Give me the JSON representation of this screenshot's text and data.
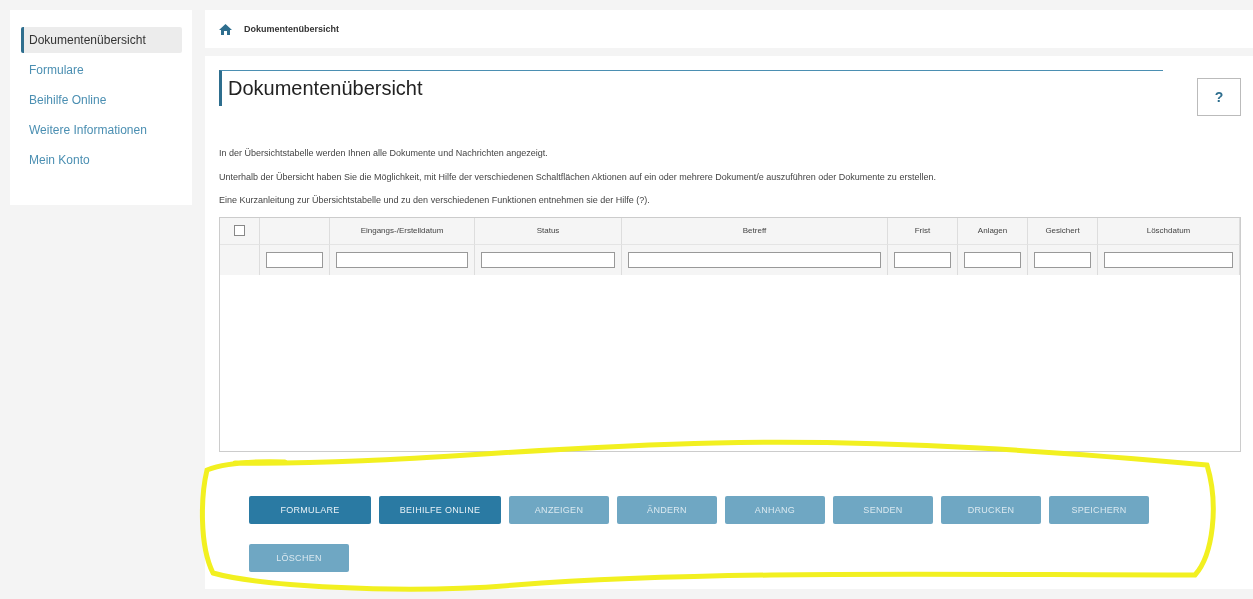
{
  "sidebar": {
    "items": [
      {
        "label": "Dokumentenübersicht",
        "selected": true
      },
      {
        "label": "Formulare",
        "selected": false
      },
      {
        "label": "Beihilfe Online",
        "selected": false
      },
      {
        "label": "Weitere Informationen",
        "selected": false
      },
      {
        "label": "Mein Konto",
        "selected": false
      }
    ]
  },
  "breadcrumb": {
    "label": "Dokumentenübersicht"
  },
  "page": {
    "title": "Dokumentenübersicht",
    "help_button": "?",
    "paragraphs": [
      "In der Übersichtstabelle werden Ihnen alle Dokumente und Nachrichten angezeigt.",
      "Unterhalb der Übersicht haben Sie die Möglichkeit, mit Hilfe der verschiedenen Schaltflächen Aktionen auf ein oder mehrere Dokument/e auszuführen oder Dokumente zu erstellen.",
      "Eine Kurzanleitung zur Übersichtstabelle und zu den verschiedenen Funktionen entnehmen sie der Hilfe (?)."
    ]
  },
  "table": {
    "select_all": {
      "checked": false
    },
    "columns": [
      {},
      {
        "label": "Eingangs-/Erstelldatum"
      },
      {
        "label": "Status"
      },
      {
        "label": "Betreff"
      },
      {
        "label": "Frist"
      },
      {
        "label": "Anlagen"
      },
      {
        "label": "Gesichert"
      },
      {
        "label": "Löschdatum"
      }
    ]
  },
  "buttons": [
    {
      "label": "FORMULARE",
      "disabled": false
    },
    {
      "label": "BEIHILFE ONLINE",
      "disabled": false
    },
    {
      "label": "ANZEIGEN",
      "disabled": true
    },
    {
      "label": "ÄNDERN",
      "disabled": true
    },
    {
      "label": "ANHANG",
      "disabled": true
    },
    {
      "label": "SENDEN",
      "disabled": true
    },
    {
      "label": "DRUCKEN",
      "disabled": true
    },
    {
      "label": "SPEICHERN",
      "disabled": true
    },
    {
      "label": "LÖSCHEN",
      "disabled": true
    }
  ]
}
